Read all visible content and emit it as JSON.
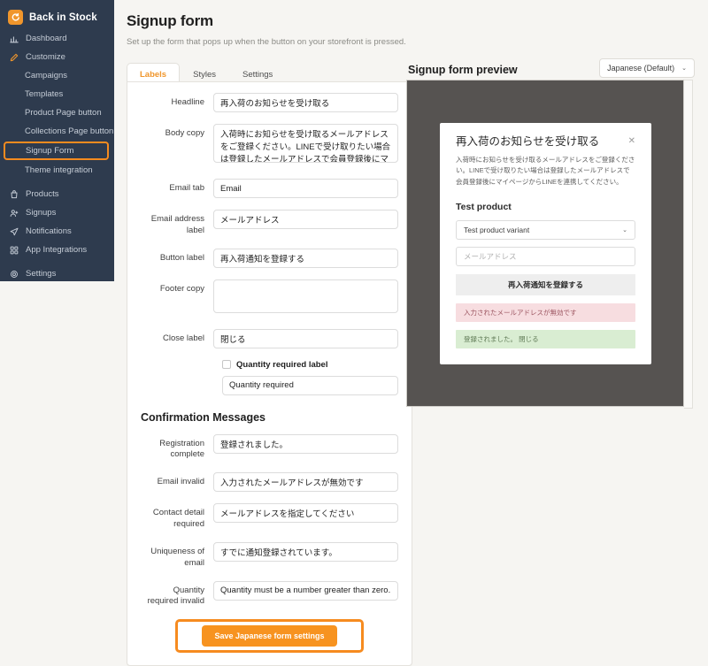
{
  "sidebar": {
    "brand": {
      "name": "Back in Stock",
      "logo_icon": "circle-arrow-logo-icon"
    },
    "items": [
      {
        "label": "Dashboard",
        "icon": "bar-chart-icon",
        "type": "top"
      },
      {
        "label": "Customize",
        "icon": "pencil-icon",
        "type": "top",
        "accent": true
      },
      {
        "label": "Campaigns",
        "type": "sub"
      },
      {
        "label": "Templates",
        "type": "sub"
      },
      {
        "label": "Product Page button",
        "type": "sub"
      },
      {
        "label": "Collections Page button",
        "type": "sub"
      },
      {
        "label": "Signup Form",
        "type": "sub",
        "selected": true
      },
      {
        "label": "Theme integration",
        "type": "sub"
      },
      {
        "label": "Products",
        "icon": "bag-icon",
        "type": "top"
      },
      {
        "label": "Signups",
        "icon": "user-plus-icon",
        "type": "top"
      },
      {
        "label": "Notifications",
        "icon": "paper-plane-icon",
        "type": "top"
      },
      {
        "label": "App Integrations",
        "icon": "grid-icon",
        "type": "top"
      },
      {
        "label": "Settings",
        "icon": "gear-icon",
        "type": "top"
      }
    ]
  },
  "header": {
    "title": "Signup form",
    "subtitle": "Set up the form that pops up when the button on your storefront is pressed."
  },
  "tabs": [
    {
      "label": "Labels",
      "active": true
    },
    {
      "label": "Styles",
      "active": false
    },
    {
      "label": "Settings",
      "active": false
    }
  ],
  "form": {
    "fields": [
      {
        "label": "Headline",
        "value": "再入荷のお知らせを受け取る",
        "kind": "input"
      },
      {
        "label": "Body copy",
        "value": "入荷時にお知らせを受け取るメールアドレスをご登録ください。LINEで受け取りたい場合は登録したメールアドレスで会員登録後にマイページからLINEを連携してください。",
        "kind": "textarea"
      },
      {
        "label": "Email tab",
        "value": "Email",
        "kind": "input"
      },
      {
        "label": "Email address label",
        "value": "メールアドレス",
        "kind": "input"
      },
      {
        "label": "Button label",
        "value": "再入荷通知を登録する",
        "kind": "input"
      },
      {
        "label": "Footer copy",
        "value": "",
        "kind": "textarea-empty"
      },
      {
        "label": "Close label",
        "value": "閉じる",
        "kind": "input"
      }
    ],
    "quantity_required": {
      "checkbox_label": "Quantity required label",
      "checked": false,
      "value": "Quantity required"
    },
    "confirmation": {
      "heading": "Confirmation Messages",
      "fields": [
        {
          "label": "Registration complete",
          "value": "登録されました。"
        },
        {
          "label": "Email invalid",
          "value": "入力されたメールアドレスが無効です"
        },
        {
          "label": "Contact detail required",
          "value": "メールアドレスを指定してください"
        },
        {
          "label": "Uniqueness of email",
          "value": "すでに通知登録されています。"
        },
        {
          "label": "Quantity required invalid",
          "value": "Quantity must be a number greater than zero."
        }
      ]
    },
    "save_label": "Save Japanese form settings"
  },
  "preview": {
    "title": "Signup form preview",
    "language": "Japanese (Default)",
    "chevron": "⌄",
    "modal": {
      "title": "再入荷のお知らせを受け取る",
      "close_icon": "✕",
      "body": "入荷時にお知らせを受け取るメールアドレスをご登録ください。LINEで受け取りたい場合は登録したメールアドレスで会員登録後にマイページからLINEを連携してください。",
      "product": "Test product",
      "variant": "Test product variant",
      "variant_chevron": "⌄",
      "email_placeholder": "メールアドレス",
      "button": "再入荷通知を登録する",
      "alert_error": "入力されたメールアドレスが無効です",
      "alert_success": "登録されました。 閉じる"
    }
  },
  "colors": {
    "brand_orange": "#f0962c",
    "sidebar_bg": "#2e3b4e",
    "page_bg": "#f6f5f2",
    "preview_bg": "#565351",
    "alert_error_bg": "#f7dde0",
    "alert_success_bg": "#d9edd2"
  }
}
